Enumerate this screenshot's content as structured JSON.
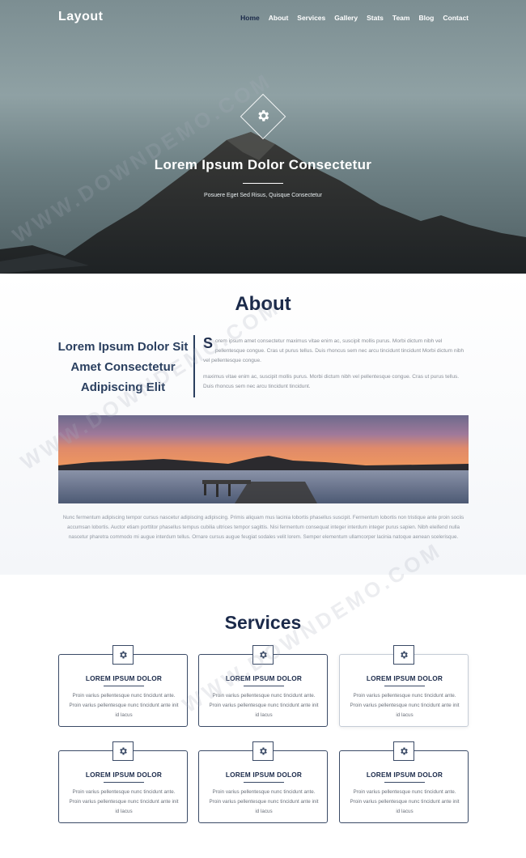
{
  "header": {
    "logo": "Layout",
    "menu": [
      "Home",
      "About",
      "Services",
      "Gallery",
      "Stats",
      "Team",
      "Blog",
      "Contact"
    ]
  },
  "hero": {
    "title": "Lorem Ipsum Dolor Consectetur",
    "subtitle": "Posuere Eget Sed Risus, Quisque Consectetur"
  },
  "about": {
    "title": "About",
    "lead": "Lorem Ipsum Dolor Sit Amet Consectetur Adipiscing Elit",
    "dropcap": "S",
    "para1": "orem ipsum amet consectetur maximus vitae enim ac, suscipit mollis purus. Morbi dictum nibh vel pellentesque congue. Cras ut purus tellus. Duis rhoncus sem nec arcu tincidunt tincidunt Morbi dictum nibh vel pellentesque congue.",
    "para2": "maximus vitae enim ac, suscipit mollis purus. Morbi dictum nibh vel pellentesque congue. Cras ut purus tellus. Duis rhoncus sem nec arcu tincidunt tincidunt.",
    "para3": "Nunc fermentum adipiscing tempor cursus nascetur adipiscing adipiscing. Primis aliquam mus lacinia lobortis phasellus suscipit. Fermentum lobortis non tristique ante proin sociis accumsan lobortis. Auctor etiam porttitor phasellus tempus cubilia ultrices tempor sagittis. Nisi fermentum consequat integer interdum integer purus sapien. Nibh eleifend nulla nascetur pharetra commodo mi augue interdum tellus. Ornare cursus augue feugiat sodales velit lorem. Semper elementum ullamcorper lacinia natoque aenean scelerisque."
  },
  "services": {
    "title": "Services",
    "cards": [
      {
        "title": "LOREM IPSUM DOLOR",
        "text": "Proin varius pellentesque nunc tincidunt ante. Proin varius pellentesque nunc tincidunt ante init id lacus"
      },
      {
        "title": "LOREM IPSUM DOLOR",
        "text": "Proin varius pellentesque nunc tincidunt ante. Proin varius pellentesque nunc tincidunt ante init id lacus"
      },
      {
        "title": "LOREM IPSUM DOLOR",
        "text": "Proin varius pellentesque nunc tincidunt ante. Proin varius pellentesque nunc tincidunt ante init id lacus"
      },
      {
        "title": "LOREM IPSUM DOLOR",
        "text": "Proin varius pellentesque nunc tincidunt ante. Proin varius pellentesque nunc tincidunt ante init id lacus"
      },
      {
        "title": "LOREM IPSUM DOLOR",
        "text": "Proin varius pellentesque nunc tincidunt ante. Proin varius pellentesque nunc tincidunt ante init id lacus"
      },
      {
        "title": "LOREM IPSUM DOLOR",
        "text": "Proin varius pellentesque nunc tincidunt ante. Proin varius pellentesque nunc tincidunt ante init id lacus"
      }
    ]
  },
  "watermark": "WWW.DOWNDEMO.COM",
  "colors": {
    "navy": "#1b2a4a",
    "accent_dark": "#3a4a66"
  },
  "icons": {
    "hero": "gear-icon",
    "cards": "gear-icon"
  }
}
